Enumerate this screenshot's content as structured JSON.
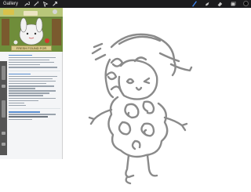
{
  "toolbar": {
    "gallery_label": "Gallery",
    "icons": [
      "wrench-icon",
      "magic-wand-icon",
      "selection-icon",
      "transform-arrow-icon",
      "brush-icon",
      "smudge-icon",
      "eraser-icon",
      "layers-icon",
      "color-icon"
    ],
    "color_value": "#0c0c0c"
  },
  "reference": {
    "caption": "FRESH FOUND FOR"
  },
  "canvas": {
    "stroke_color": "#8a8a8a"
  }
}
